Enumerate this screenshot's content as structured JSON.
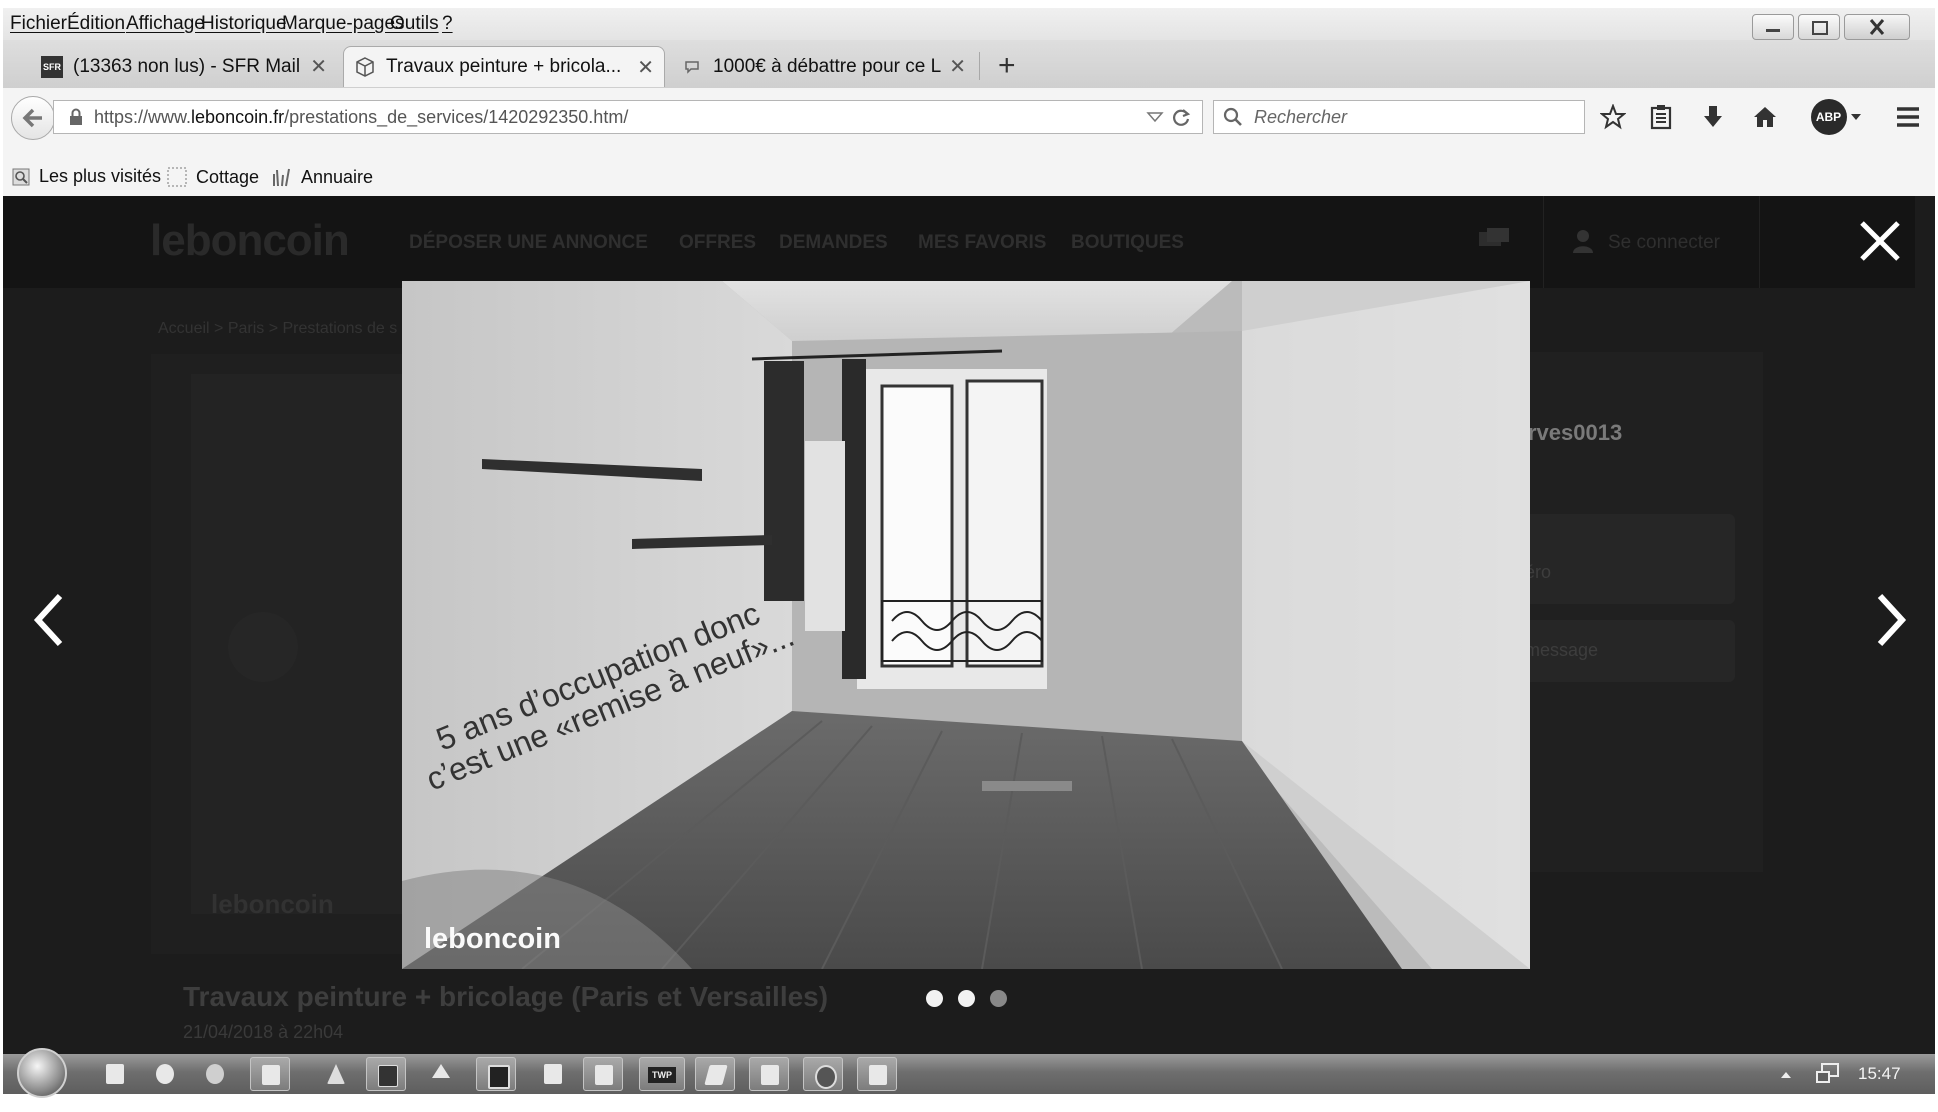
{
  "menu": {
    "items": [
      "Fichier",
      "Édition",
      "Affichage",
      "Historique",
      "Marque-pages",
      "Outils",
      "?"
    ]
  },
  "tabs": [
    {
      "label": "(13363 non lus) - SFR Mail ...",
      "icon": "sfr-icon",
      "favicon_text": "SFR",
      "close": "✕"
    },
    {
      "label": "Travaux peinture + bricola...",
      "icon": "box-icon",
      "close": "✕"
    },
    {
      "label": "1000€ à débattre pour ce L...",
      "icon": "chat-icon",
      "close": "✕"
    }
  ],
  "new_tab": "+",
  "navbar": {
    "url_prefix": "https://www.",
    "url_domain": "leboncoin.fr",
    "url_path": "/prestations_de_services/1420292350.htm/",
    "search_placeholder": "Rechercher",
    "abp": "ABP"
  },
  "bookmarks": [
    {
      "label": "Les plus visités",
      "icon": "most-visited-icon"
    },
    {
      "label": "Cottage",
      "icon": "folder-icon"
    },
    {
      "label": "Annuaire",
      "icon": "directory-icon"
    }
  ],
  "site": {
    "logo": "leboncoin",
    "nav": [
      "DÉPOSER UNE ANNONCE",
      "OFFRES",
      "DEMANDES",
      "MES FAVORIS",
      "BOUTIQUES"
    ],
    "login": "Se connecter",
    "breadcrumb": "Accueil > Paris > Prestations de s",
    "ad_title": "Travaux peinture + bricolage (Paris et Versailles)",
    "ad_date": "21/04/2018 à 22h04",
    "seller_username": "rves0013",
    "btn_phone": "éro",
    "btn_message": "message",
    "watermark_bg": "leboncoin"
  },
  "lightbox": {
    "photo_caption_line1": "5 ans d’occupation donc",
    "photo_caption_line2": "c’est une «remise à neuf»...",
    "photo_watermark": "leboncoin",
    "dots": [
      true,
      true,
      false
    ]
  },
  "taskbar": {
    "time": "15:47",
    "twp_label": "TWP"
  }
}
